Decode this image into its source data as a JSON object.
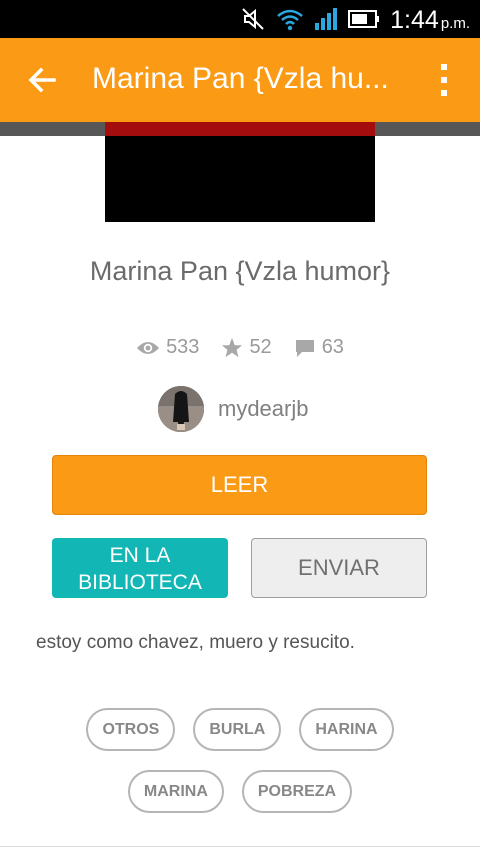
{
  "status_bar": {
    "time": "1:44",
    "ampm": "p.m."
  },
  "app_bar": {
    "title": "Marina Pan {Vzla hu..."
  },
  "story": {
    "title": "Marina Pan {Vzla humor}",
    "views": "533",
    "votes": "52",
    "comments": "63",
    "author": "mydearjb",
    "description": "estoy como chavez, muero y resucito."
  },
  "buttons": {
    "read": "LEER",
    "library_line1": "EN LA",
    "library_line2": "BIBLIOTECA",
    "send": "ENVIAR"
  },
  "tags": [
    [
      "OTROS",
      "BURLA",
      "HARINA"
    ],
    [
      "MARINA",
      "POBREZA"
    ]
  ],
  "colors": {
    "accent": "#fb9a14",
    "teal": "#12b6b4"
  }
}
